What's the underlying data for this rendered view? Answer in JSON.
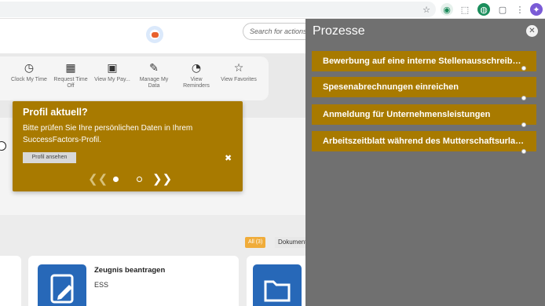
{
  "browser": {
    "icons": [
      "star-icon",
      "extension-icon",
      "puzzle-icon",
      "profile-icon",
      "split-view-icon",
      "menu-icon"
    ]
  },
  "header": {
    "search_placeholder": "Search for actions or people"
  },
  "quick_actions": [
    {
      "icon": "clock-icon",
      "label": "Clock My Time"
    },
    {
      "icon": "calendar-icon",
      "label": "Request Time Off"
    },
    {
      "icon": "pay-icon",
      "label": "View My Pay..."
    },
    {
      "icon": "edit-person-icon",
      "label": "Manage My Data"
    },
    {
      "icon": "reminder-icon",
      "label": "View Reminders"
    },
    {
      "icon": "star-icon",
      "label": "View Favorites"
    }
  ],
  "popover": {
    "title": "Profil aktuell?",
    "text": "Bitte prüfen Sie Ihre persönlichen Daten in Ihrem SuccessFactors-Profil.",
    "button_label": "Profil ansehen",
    "close": "✖",
    "prev": "❮❮",
    "next": "❯❯"
  },
  "filters": {
    "all_label": "All (3)",
    "doc_label": "Dokumente"
  },
  "cards": [
    {
      "title": "Zeugnis beantragen",
      "subtitle": "ESS"
    }
  ],
  "panel": {
    "title": "Prozesse",
    "close": "✕",
    "items": [
      "Bewerbung auf eine interne Stellenausschreibung",
      "Spesenabrechnungen einreichen",
      "Anmeldung für Unternehmensleistungen",
      "Arbeitszeitblatt während des Mutterschaftsurlaubs"
    ]
  },
  "colors": {
    "accent": "#a87a00",
    "panel_bg": "#707070",
    "tile_blue": "#2768b8",
    "chip_orange": "#f0ac3a"
  }
}
